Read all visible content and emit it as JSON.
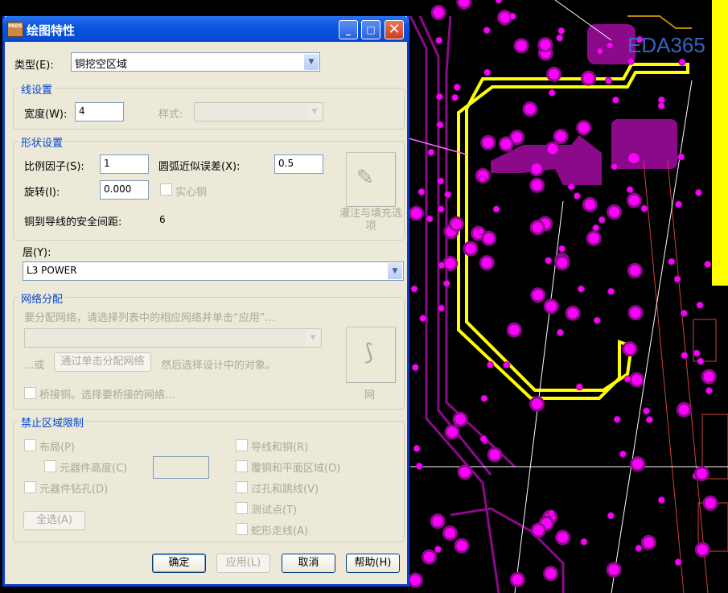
{
  "watermark": "EDA365",
  "dialog": {
    "title": "绘图特性",
    "app_icon_text": "PADS",
    "type_label": "类型(E):",
    "type_value": "铜挖空区域",
    "line_group": {
      "title": "线设置",
      "width_label": "宽度(W):",
      "width_value": "4",
      "style_label": "样式:"
    },
    "shape_group": {
      "title": "形状设置",
      "scale_label": "比例因子(S):",
      "scale_value": "1",
      "arc_label": "圆弧近似误差(X):",
      "arc_value": "0.5",
      "rotation_label": "旋转(I):",
      "rotation_value": "0.000",
      "solid_label": "实心铜",
      "clearance_label": "铜到导线的安全间距:",
      "clearance_value": "6",
      "flood_button": "灌注与填充选项"
    },
    "layer_label": "层(Y):",
    "layer_value": "L3 POWER",
    "net_group": {
      "title": "网络分配",
      "hint": "要分配网络，请选择列表中的相应网络并单击“应用”...",
      "or_label": "...或",
      "click_assign_button": "通过单击分配网络",
      "then_label": "然后选择设计中的对象。",
      "bridge_label": "桥接铜。选择要桥接的网络...",
      "net_button": "网"
    },
    "keepout_group": {
      "title": "禁止区域限制",
      "placement": "布局(P)",
      "component_height": "元器件高度(C)",
      "component_drill": "元器件钻孔(D)",
      "traces_copper": "导线和铜(R)",
      "copper_plane": "覆铜和平面区域(O)",
      "vias_jumpers": "过孔和跳线(V)",
      "test_points": "测试点(T)",
      "serpentine": "蛇形走线(A)",
      "select_all": "全选(A)"
    },
    "buttons": {
      "ok": "确定",
      "apply": "应用(L)",
      "cancel": "取消",
      "help": "帮助(H)"
    }
  }
}
